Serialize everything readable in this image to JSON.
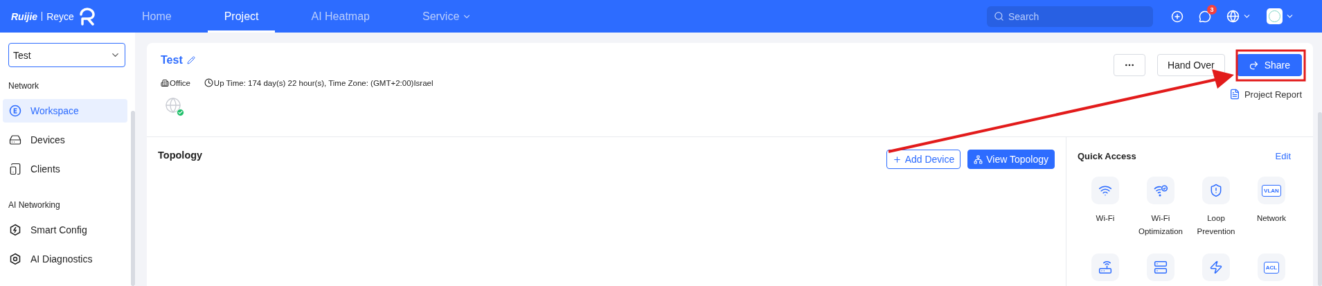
{
  "header": {
    "logo": {
      "brand": "Ruijie",
      "product": "Reyce"
    },
    "nav": [
      {
        "label": "Home",
        "selected": false,
        "dropdown": false
      },
      {
        "label": "Project",
        "selected": true,
        "dropdown": false
      },
      {
        "label": "AI Heatmap",
        "selected": false,
        "dropdown": false
      },
      {
        "label": "Service",
        "selected": false,
        "dropdown": true
      }
    ],
    "search": {
      "placeholder": "Search"
    },
    "notification_count": "3"
  },
  "sidebar": {
    "project_select": "Test",
    "sections": [
      {
        "title": "Network",
        "items": [
          {
            "label": "Workspace",
            "selected": true
          },
          {
            "label": "Devices",
            "selected": false
          },
          {
            "label": "Clients",
            "selected": false
          }
        ]
      },
      {
        "title": "AI Networking",
        "items": [
          {
            "label": "Smart Config",
            "selected": false
          },
          {
            "label": "AI Diagnostics",
            "selected": false
          }
        ]
      }
    ]
  },
  "project": {
    "name": "Test",
    "scene": "Office",
    "uptime": "Up Time: 174 day(s) 22 hour(s), Time Zone: (GMT+2:00)Israel",
    "online": true,
    "actions": [
      {
        "kind": "more"
      },
      {
        "kind": "plain",
        "label": "Hand Over"
      },
      {
        "kind": "primary",
        "label": "Share"
      }
    ],
    "report_link": "Project Report"
  },
  "topology": {
    "title": "Topology",
    "buttons": [
      {
        "kind": "outline",
        "label": "Add Device"
      },
      {
        "kind": "primary",
        "label": "View Topology"
      }
    ]
  },
  "quick_access": {
    "title": "Quick Access",
    "edit": "Edit",
    "items": [
      {
        "kind": "icon",
        "label": "Wi-Fi"
      },
      {
        "kind": "icon",
        "label": "Wi-Fi Optimization"
      },
      {
        "kind": "icon",
        "label": "Loop Prevention"
      },
      {
        "kind": "tag",
        "icon_text": "VLAN",
        "label": "Network"
      },
      {
        "kind": "icon"
      },
      {
        "kind": "icon"
      },
      {
        "kind": "icon"
      },
      {
        "kind": "tag",
        "icon_text": "ACL"
      }
    ]
  }
}
